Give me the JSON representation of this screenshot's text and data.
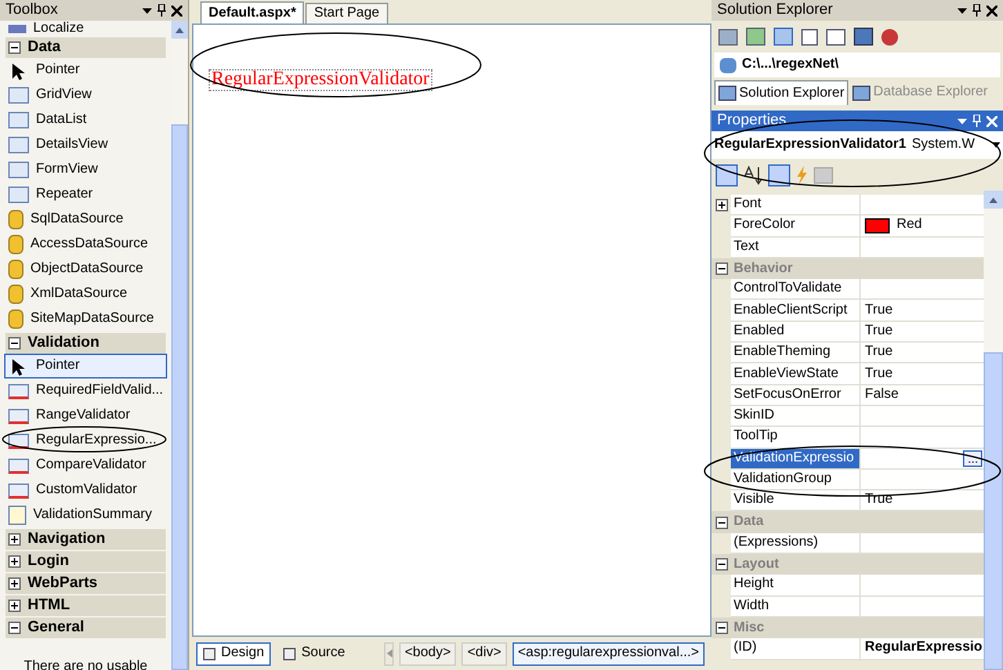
{
  "toolbox": {
    "title": "Toolbox",
    "cut_item": "Localize",
    "sections": [
      {
        "label": "Data",
        "expanded": true,
        "items": [
          {
            "label": "Pointer",
            "kind": "pointer",
            "selected": false
          },
          {
            "label": "GridView",
            "kind": "control",
            "selected": false
          },
          {
            "label": "DataList",
            "kind": "control",
            "selected": false
          },
          {
            "label": "DetailsView",
            "kind": "control",
            "selected": false
          },
          {
            "label": "FormView",
            "kind": "control",
            "selected": false
          },
          {
            "label": "Repeater",
            "kind": "control",
            "selected": false
          },
          {
            "label": "SqlDataSource",
            "kind": "datasource",
            "selected": false
          },
          {
            "label": "AccessDataSource",
            "kind": "datasource",
            "selected": false
          },
          {
            "label": "ObjectDataSource",
            "kind": "datasource",
            "selected": false
          },
          {
            "label": "XmlDataSource",
            "kind": "datasource",
            "selected": false
          },
          {
            "label": "SiteMapDataSource",
            "kind": "datasource",
            "selected": false
          }
        ]
      },
      {
        "label": "Validation",
        "expanded": true,
        "items": [
          {
            "label": "Pointer",
            "kind": "pointer",
            "selected": true
          },
          {
            "label": "RequiredFieldValid...",
            "kind": "validator",
            "selected": false
          },
          {
            "label": "RangeValidator",
            "kind": "validator",
            "selected": false
          },
          {
            "label": "RegularExpressio...",
            "kind": "validator",
            "selected": false
          },
          {
            "label": "CompareValidator",
            "kind": "validator",
            "selected": false
          },
          {
            "label": "CustomValidator",
            "kind": "validator",
            "selected": false
          },
          {
            "label": "ValidationSummary",
            "kind": "summary",
            "selected": false
          }
        ]
      },
      {
        "label": "Navigation",
        "expanded": false
      },
      {
        "label": "Login",
        "expanded": false
      },
      {
        "label": "WebParts",
        "expanded": false
      },
      {
        "label": "HTML",
        "expanded": false
      },
      {
        "label": "General",
        "expanded": true
      }
    ],
    "empty_text": "There are no usable"
  },
  "editor": {
    "tabs": [
      {
        "label": "Default.aspx*",
        "selected": true
      },
      {
        "label": "Start Page",
        "selected": false
      }
    ],
    "validator_text": "RegularExpressionValidator",
    "view_buttons": [
      {
        "label": "Design",
        "selected": true
      },
      {
        "label": "Source",
        "selected": false
      }
    ],
    "breadcrumbs": [
      {
        "label": "<body>",
        "selected": false
      },
      {
        "label": "<div>",
        "selected": false
      },
      {
        "label": "<asp:regularexpressionval...>",
        "selected": true
      }
    ]
  },
  "solution_explorer": {
    "title": "Solution Explorer",
    "path": "C:\\...\\regexNet\\",
    "tabs": [
      {
        "label": "Solution Explorer",
        "selected": true
      },
      {
        "label": "Database Explorer",
        "selected": false
      }
    ]
  },
  "properties": {
    "title": "Properties",
    "object_name": "RegularExpressionValidator1",
    "object_type": "System.W",
    "rows": [
      {
        "kind": "group",
        "name": "Font",
        "value": "",
        "selected": false
      },
      {
        "kind": "property",
        "name": "ForeColor",
        "value": "Red",
        "color": "#ff0000",
        "selected": false
      },
      {
        "kind": "property",
        "name": "Text",
        "value": "",
        "selected": false
      },
      {
        "kind": "category",
        "name": "Behavior",
        "expanded": true
      },
      {
        "kind": "property",
        "name": "ControlToValidate",
        "value": "",
        "selected": false
      },
      {
        "kind": "property",
        "name": "EnableClientScript",
        "value": "True",
        "selected": false
      },
      {
        "kind": "property",
        "name": "Enabled",
        "value": "True",
        "selected": false
      },
      {
        "kind": "property",
        "name": "EnableTheming",
        "value": "True",
        "selected": false
      },
      {
        "kind": "property",
        "name": "EnableViewState",
        "value": "True",
        "selected": false
      },
      {
        "kind": "property",
        "name": "SetFocusOnError",
        "value": "False",
        "selected": false
      },
      {
        "kind": "property",
        "name": "SkinID",
        "value": "",
        "selected": false
      },
      {
        "kind": "property",
        "name": "ToolTip",
        "value": "",
        "selected": false
      },
      {
        "kind": "property",
        "name": "ValidationExpressio",
        "value": "",
        "selected": true,
        "ellipsis": "..."
      },
      {
        "kind": "property",
        "name": "ValidationGroup",
        "value": "",
        "selected": false
      },
      {
        "kind": "property",
        "name": "Visible",
        "value": "True",
        "selected": false
      },
      {
        "kind": "category",
        "name": "Data",
        "expanded": true
      },
      {
        "kind": "property",
        "name": "(Expressions)",
        "value": "",
        "selected": false
      },
      {
        "kind": "category",
        "name": "Layout",
        "expanded": true
      },
      {
        "kind": "property",
        "name": "Height",
        "value": "",
        "selected": false
      },
      {
        "kind": "property",
        "name": "Width",
        "value": "",
        "selected": false
      },
      {
        "kind": "category",
        "name": "Misc",
        "expanded": true
      },
      {
        "kind": "property",
        "name": "(ID)",
        "value": "RegularExpressio",
        "bold": true,
        "selected": false
      }
    ]
  }
}
